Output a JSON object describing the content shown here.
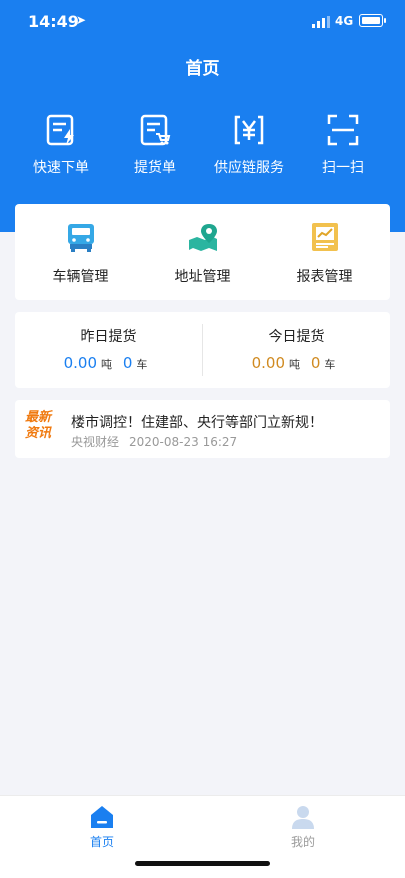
{
  "status": {
    "time": "14:49",
    "network": "4G"
  },
  "header": {
    "title": "首页"
  },
  "quick_actions": [
    {
      "label": "快速下单",
      "icon": "quick-order-icon"
    },
    {
      "label": "提货单",
      "icon": "delivery-order-icon"
    },
    {
      "label": "供应链服务",
      "icon": "yen-icon"
    },
    {
      "label": "扫一扫",
      "icon": "scan-icon"
    }
  ],
  "management": [
    {
      "label": "车辆管理",
      "icon": "truck-icon"
    },
    {
      "label": "地址管理",
      "icon": "map-pin-icon"
    },
    {
      "label": "报表管理",
      "icon": "report-icon"
    }
  ],
  "stats": {
    "yesterday": {
      "title": "昨日提货",
      "tons": "0.00",
      "ton_unit": "吨",
      "cars": "0",
      "car_unit": "车",
      "color": "#1a7ff0"
    },
    "today": {
      "title": "今日提货",
      "tons": "0.00",
      "ton_unit": "吨",
      "cars": "0",
      "car_unit": "车",
      "color": "#d08a20"
    }
  },
  "news": {
    "badge": "最新资讯",
    "title": "楼市调控！住建部、央行等部门立新规！",
    "source": "央视财经",
    "date": "2020-08-23 16:27"
  },
  "tabs": [
    {
      "label": "首页",
      "active": true,
      "icon": "home-icon"
    },
    {
      "label": "我的",
      "active": false,
      "icon": "user-icon"
    }
  ],
  "colors": {
    "primary": "#1a7ff0",
    "accent": "#f07a10",
    "today_value": "#d08a20",
    "inactive_tab": "#9a9a9a"
  }
}
